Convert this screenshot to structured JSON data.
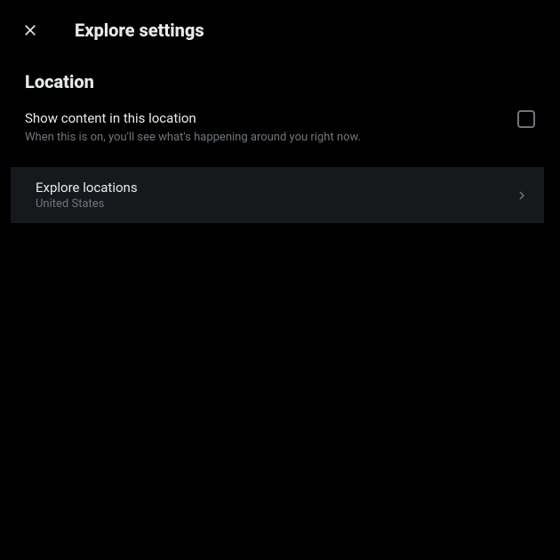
{
  "header": {
    "title": "Explore settings"
  },
  "section": {
    "title": "Location"
  },
  "showContent": {
    "label": "Show content in this location",
    "description": "When this is on, you'll see what's happening around you right now."
  },
  "exploreLocations": {
    "label": "Explore locations",
    "value": "United States"
  }
}
